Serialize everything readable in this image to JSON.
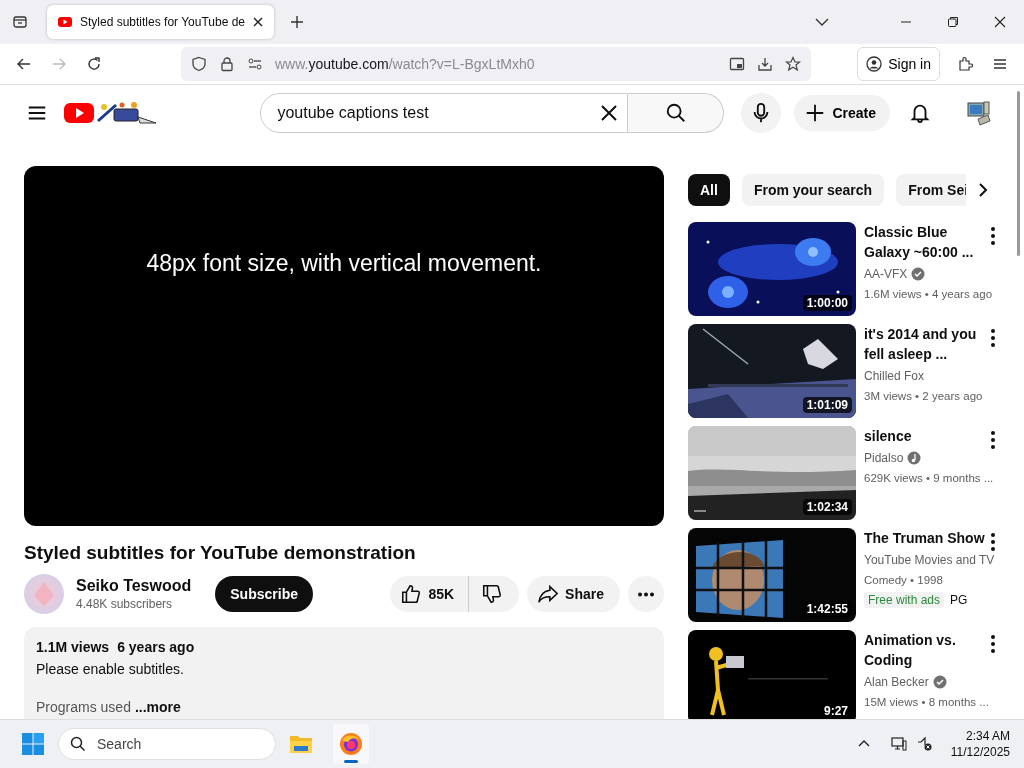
{
  "browser": {
    "tab_title": "Styled subtitles for YouTube de",
    "url": {
      "prefix": "www.",
      "host": "youtube.com",
      "path": "/watch?v=L-BgxLtMxh0"
    },
    "sign_in": "Sign in"
  },
  "header": {
    "search_query": "youtube captions test",
    "create": "Create"
  },
  "video": {
    "caption": "48px font size, with vertical movement.",
    "title": "Styled subtitles for YouTube demonstration",
    "channel": "Seiko Teswood",
    "subscribers": "4.48K subscribers",
    "subscribe": "Subscribe",
    "likes": "85K",
    "share": "Share"
  },
  "description": {
    "views": "1.1M views",
    "age": "6 years ago",
    "line": "Please enable subtitles.",
    "cut_line": "Programs used",
    "more": "...more"
  },
  "chips": [
    {
      "label": "All",
      "selected": true
    },
    {
      "label": "From your search",
      "selected": false
    },
    {
      "label": "From Sei",
      "selected": false
    }
  ],
  "recommendations": [
    {
      "duration": "1:00:00",
      "title": "Classic Blue Galaxy ~60:00 ...",
      "channel": "AA-VFX",
      "verified": true,
      "artist": false,
      "meta": "1.6M views • 4 years ago"
    },
    {
      "duration": "1:01:09",
      "title": "it's 2014 and you fell asleep ...",
      "channel": "Chilled Fox",
      "verified": false,
      "artist": false,
      "meta": "3M views • 2 years ago"
    },
    {
      "duration": "1:02:34",
      "title": "silence",
      "channel": "Pidalso",
      "verified": false,
      "artist": true,
      "meta": "629K views • 9 months ..."
    },
    {
      "duration": "1:42:55",
      "title": "The Truman Show",
      "channel": "YouTube Movies and TV",
      "verified": false,
      "artist": false,
      "meta": "Comedy • 1998",
      "badges": [
        "Free with ads",
        "PG"
      ]
    },
    {
      "duration": "9:27",
      "title": "Animation vs. Coding",
      "channel": "Alan Becker",
      "verified": true,
      "artist": false,
      "meta": "15M views • 8 months ..."
    }
  ],
  "taskbar": {
    "search_placeholder": "Search",
    "time": "2:34 AM",
    "date": "11/12/2025"
  }
}
